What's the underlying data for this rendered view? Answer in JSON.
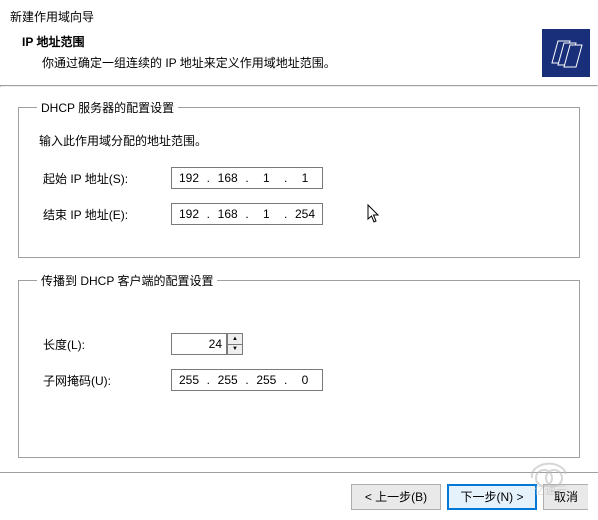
{
  "dialog_title": "新建作用域向导",
  "header": {
    "heading": "IP 地址范围",
    "subtitle": "你通过确定一组连续的 IP 地址来定义作用域地址范围。"
  },
  "group_server": {
    "legend": "DHCP 服务器的配置设置",
    "instruction": "输入此作用域分配的地址范围。",
    "start_label": "起始 IP 地址(S):",
    "end_label": "结束 IP 地址(E):",
    "start_ip": {
      "o1": "192",
      "o2": "168",
      "o3": "1",
      "o4": "1"
    },
    "end_ip": {
      "o1": "192",
      "o2": "168",
      "o3": "1",
      "o4": "254"
    }
  },
  "group_client": {
    "legend": "传播到 DHCP 客户端的配置设置",
    "length_label": "长度(L):",
    "length_value": "24",
    "mask_label": "子网掩码(U):",
    "mask": {
      "o1": "255",
      "o2": "255",
      "o3": "255",
      "o4": "0"
    }
  },
  "buttons": {
    "back": "< 上一步(B)",
    "next": "下一步(N) >",
    "cancel": "取消"
  },
  "watermark_text": "亿速云"
}
